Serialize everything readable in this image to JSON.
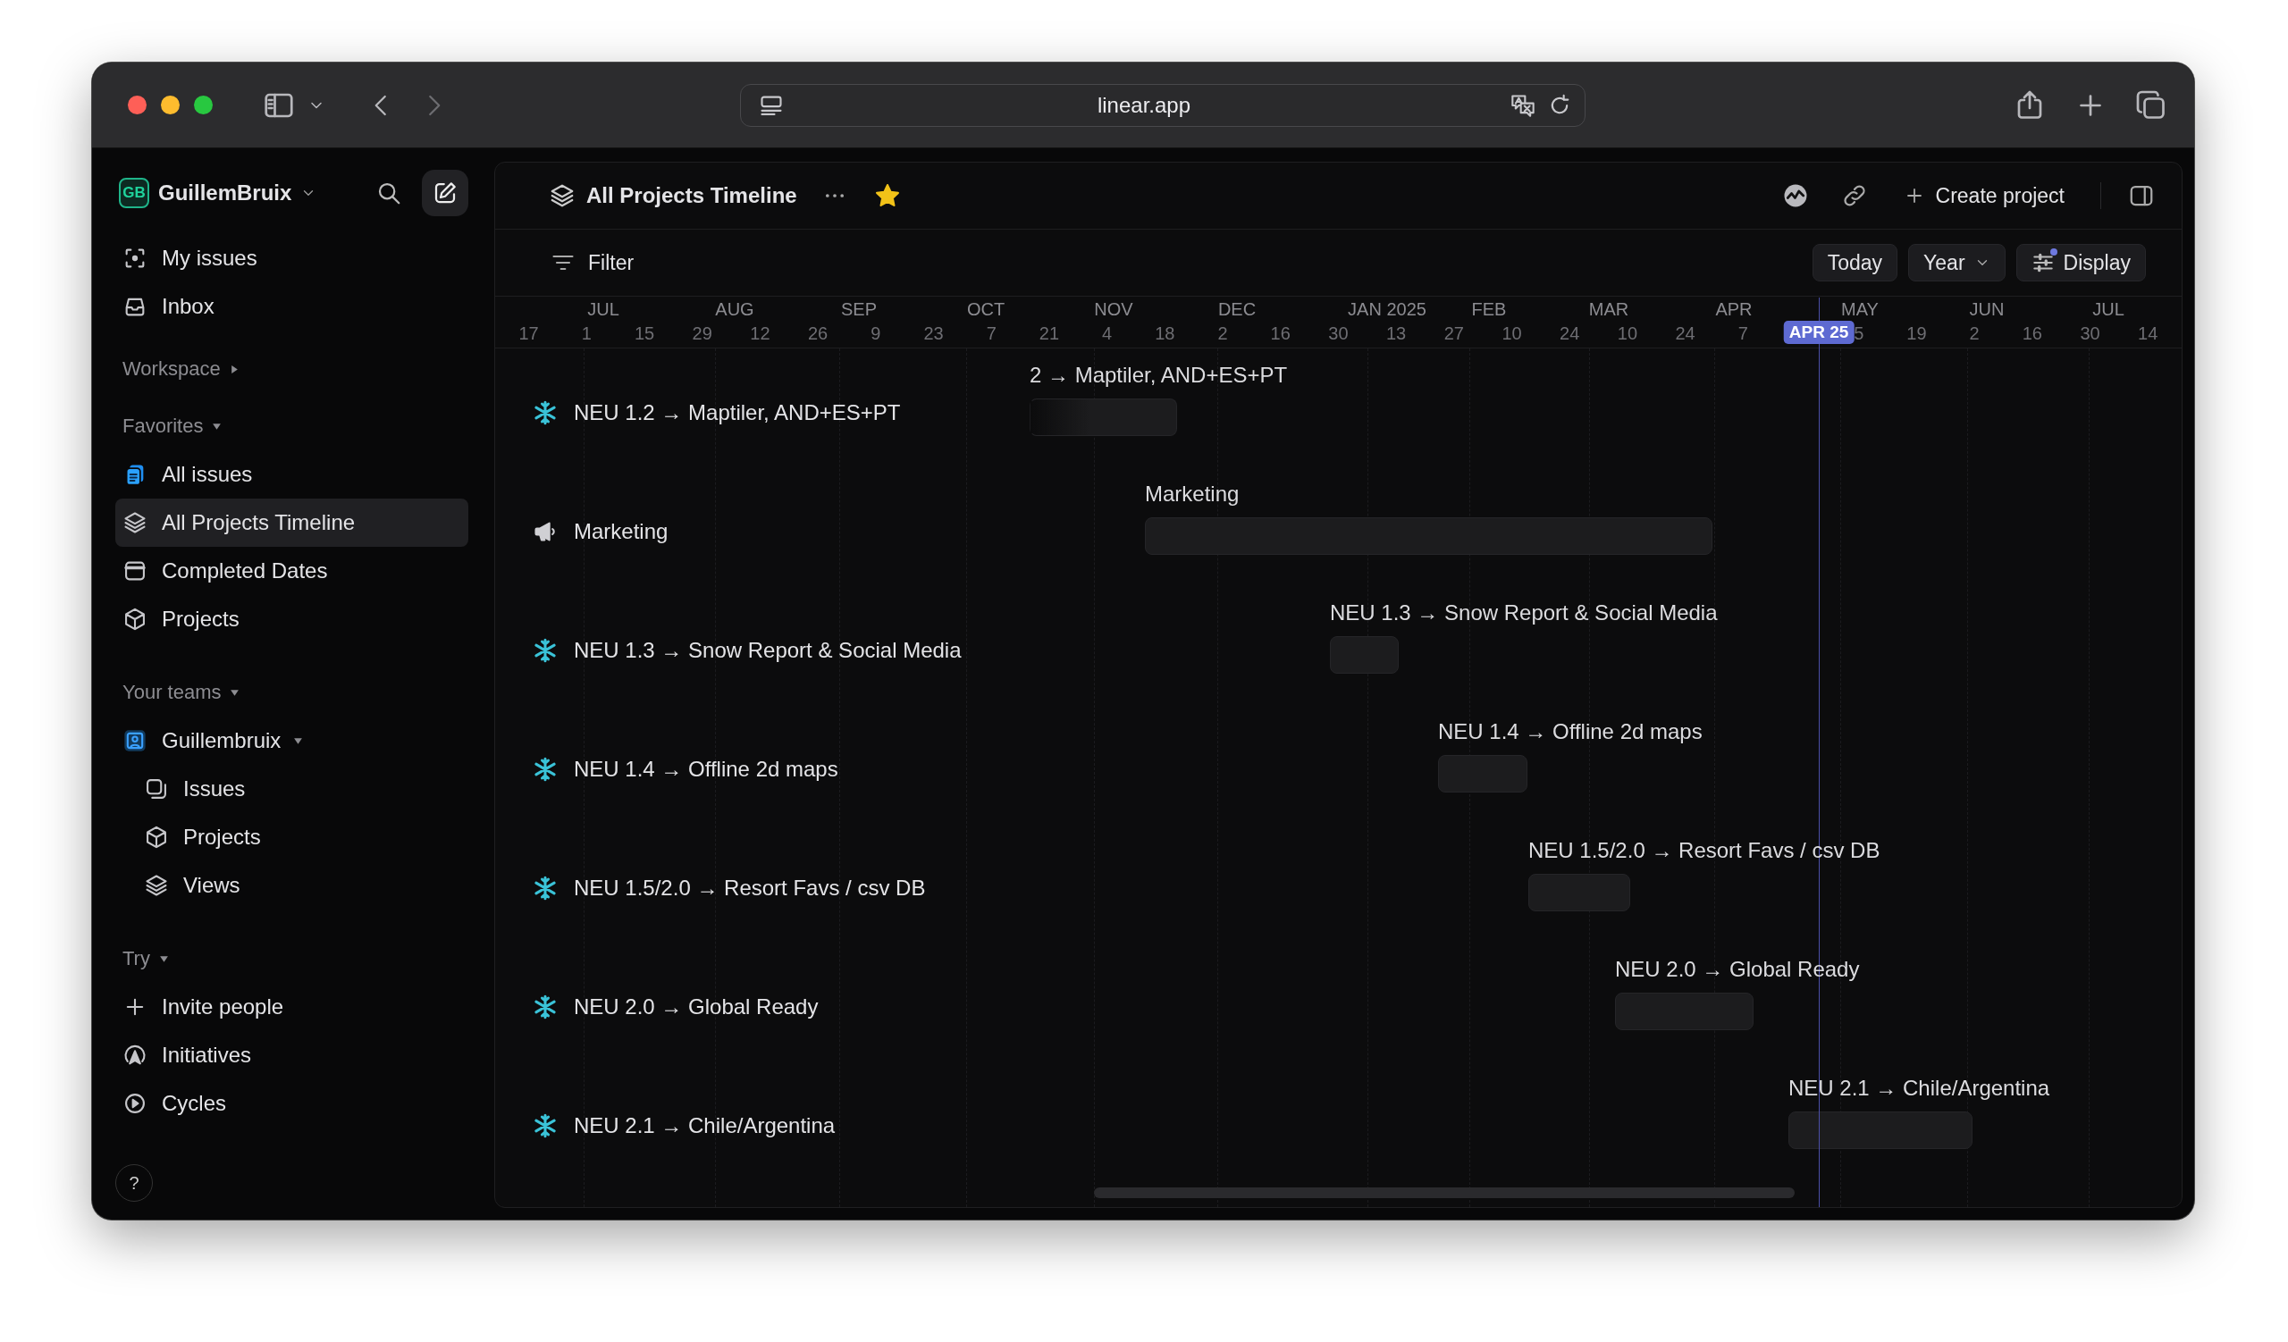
{
  "browser": {
    "url": "linear.app"
  },
  "sidebar": {
    "workspace": {
      "initials": "GB",
      "name": "GuillemBruix"
    },
    "top_items": [
      {
        "label": "My issues",
        "selected": false
      },
      {
        "label": "Inbox",
        "selected": false
      }
    ],
    "sections": [
      {
        "title": "Workspace",
        "expanded": false
      },
      {
        "title": "Favorites",
        "expanded": true,
        "items": [
          {
            "label": "All issues",
            "selected": false
          },
          {
            "label": "All Projects Timeline",
            "selected": true
          },
          {
            "label": "Completed Dates",
            "selected": false
          },
          {
            "label": "Projects",
            "selected": false
          }
        ]
      },
      {
        "title": "Your teams",
        "expanded": true,
        "items": [
          {
            "label": "Guillembruix",
            "selected": false,
            "expanded": true,
            "children": [
              {
                "label": "Issues",
                "selected": false
              },
              {
                "label": "Projects",
                "selected": false
              },
              {
                "label": "Views",
                "selected": false
              }
            ]
          }
        ]
      },
      {
        "title": "Try",
        "expanded": true,
        "items": [
          {
            "label": "Invite people",
            "selected": false
          },
          {
            "label": "Initiatives",
            "selected": false
          },
          {
            "label": "Cycles",
            "selected": false
          }
        ]
      }
    ],
    "help": "?"
  },
  "header": {
    "title": "All Projects Timeline",
    "favorite": true,
    "create_button": "Create project"
  },
  "toolbar": {
    "filter": "Filter",
    "today": "Today",
    "zoom": "Year",
    "display": "Display"
  },
  "timeline": {
    "months": [
      "JUL",
      "AUG",
      "SEP",
      "OCT",
      "NOV",
      "DEC",
      "JAN 2025",
      "FEB",
      "MAR",
      "APR",
      "MAY",
      "JUN",
      "JUL"
    ],
    "dates": [
      "17",
      "1",
      "15",
      "29",
      "12",
      "26",
      "9",
      "23",
      "7",
      "21",
      "4",
      "18",
      "2",
      "16",
      "30",
      "13",
      "27",
      "10",
      "24",
      "10",
      "24",
      "7",
      "5",
      "19",
      "2",
      "16",
      "30",
      "14"
    ],
    "today": "APR 25",
    "projects": [
      {
        "kind": "milestone",
        "name": "NEU 1.2 → Maptiler, AND+ES+PT",
        "bar_label": "2 → Maptiler, AND+ES+PT"
      },
      {
        "kind": "marketing",
        "name": "Marketing",
        "bar_label": "Marketing"
      },
      {
        "kind": "milestone",
        "name": "NEU 1.3 → Snow Report & Social Media",
        "bar_label": "NEU 1.3 → Snow Report & Social Media"
      },
      {
        "kind": "milestone",
        "name": "NEU 1.4 → Offline 2d maps",
        "bar_label": "NEU 1.4 → Offline 2d maps"
      },
      {
        "kind": "milestone",
        "name": "NEU 1.5/2.0 → Resort Favs / csv DB",
        "bar_label": "NEU 1.5/2.0 → Resort Favs / csv DB"
      },
      {
        "kind": "milestone",
        "name": "NEU 2.0 → Global Ready",
        "bar_label": "NEU 2.0 → Global Ready"
      },
      {
        "kind": "milestone",
        "name": "NEU 2.1 → Chile/Argentina",
        "bar_label": "NEU 2.1 → Chile/Argentina"
      }
    ]
  }
}
